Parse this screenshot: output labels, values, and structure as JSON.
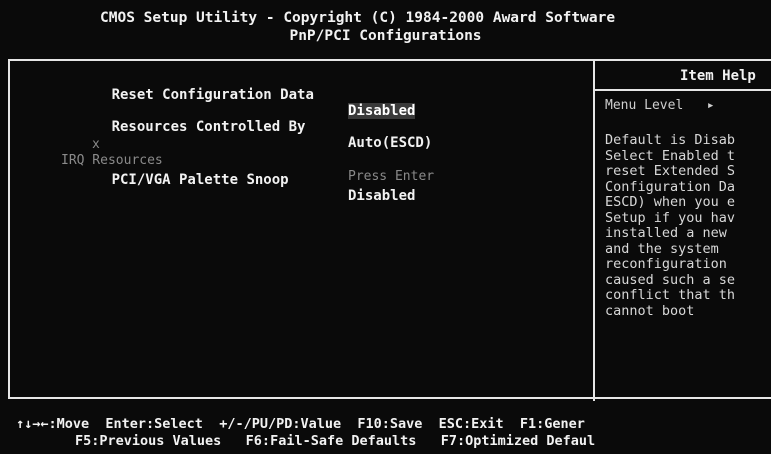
{
  "header": {
    "line1": "CMOS Setup Utility - Copyright (C) 1984-2000 Award Software",
    "line2": "PnP/PCI Configurations"
  },
  "settings": [
    {
      "label": "Reset Configuration Data",
      "value": "Disabled",
      "selected": true,
      "disabled": false
    },
    {
      "label": "Resources Controlled By",
      "value": "Auto(ESCD)",
      "selected": false,
      "disabled": false
    },
    {
      "label": "IRQ Resources",
      "value": "Press Enter",
      "selected": false,
      "disabled": true,
      "marker": "x"
    },
    {
      "label": "PCI/VGA Palette Snoop",
      "value": "Disabled",
      "selected": false,
      "disabled": false
    }
  ],
  "help": {
    "title": "Item Help",
    "menu_level": "Menu Level   ▸",
    "text": "Default is Disab\nSelect Enabled t\nreset Extended S\nConfiguration Da\nESCD) when you e\nSetup if you hav\ninstalled a new\nand the system\nreconfiguration\ncaused such a se\nconflict that th\ncannot boot"
  },
  "footer": {
    "line1": "↑↓→←:Move  Enter:Select  +/-/PU/PD:Value  F10:Save  ESC:Exit  F1:Gener",
    "line2": "F5:Previous Values   F6:Fail-Safe Defaults   F7:Optimized Defaul"
  },
  "colors": {
    "background": "#0a0a0a",
    "text": "#f2f2f2",
    "disabled_text": "#8a8a8a",
    "highlight": "#3a3a3a"
  }
}
